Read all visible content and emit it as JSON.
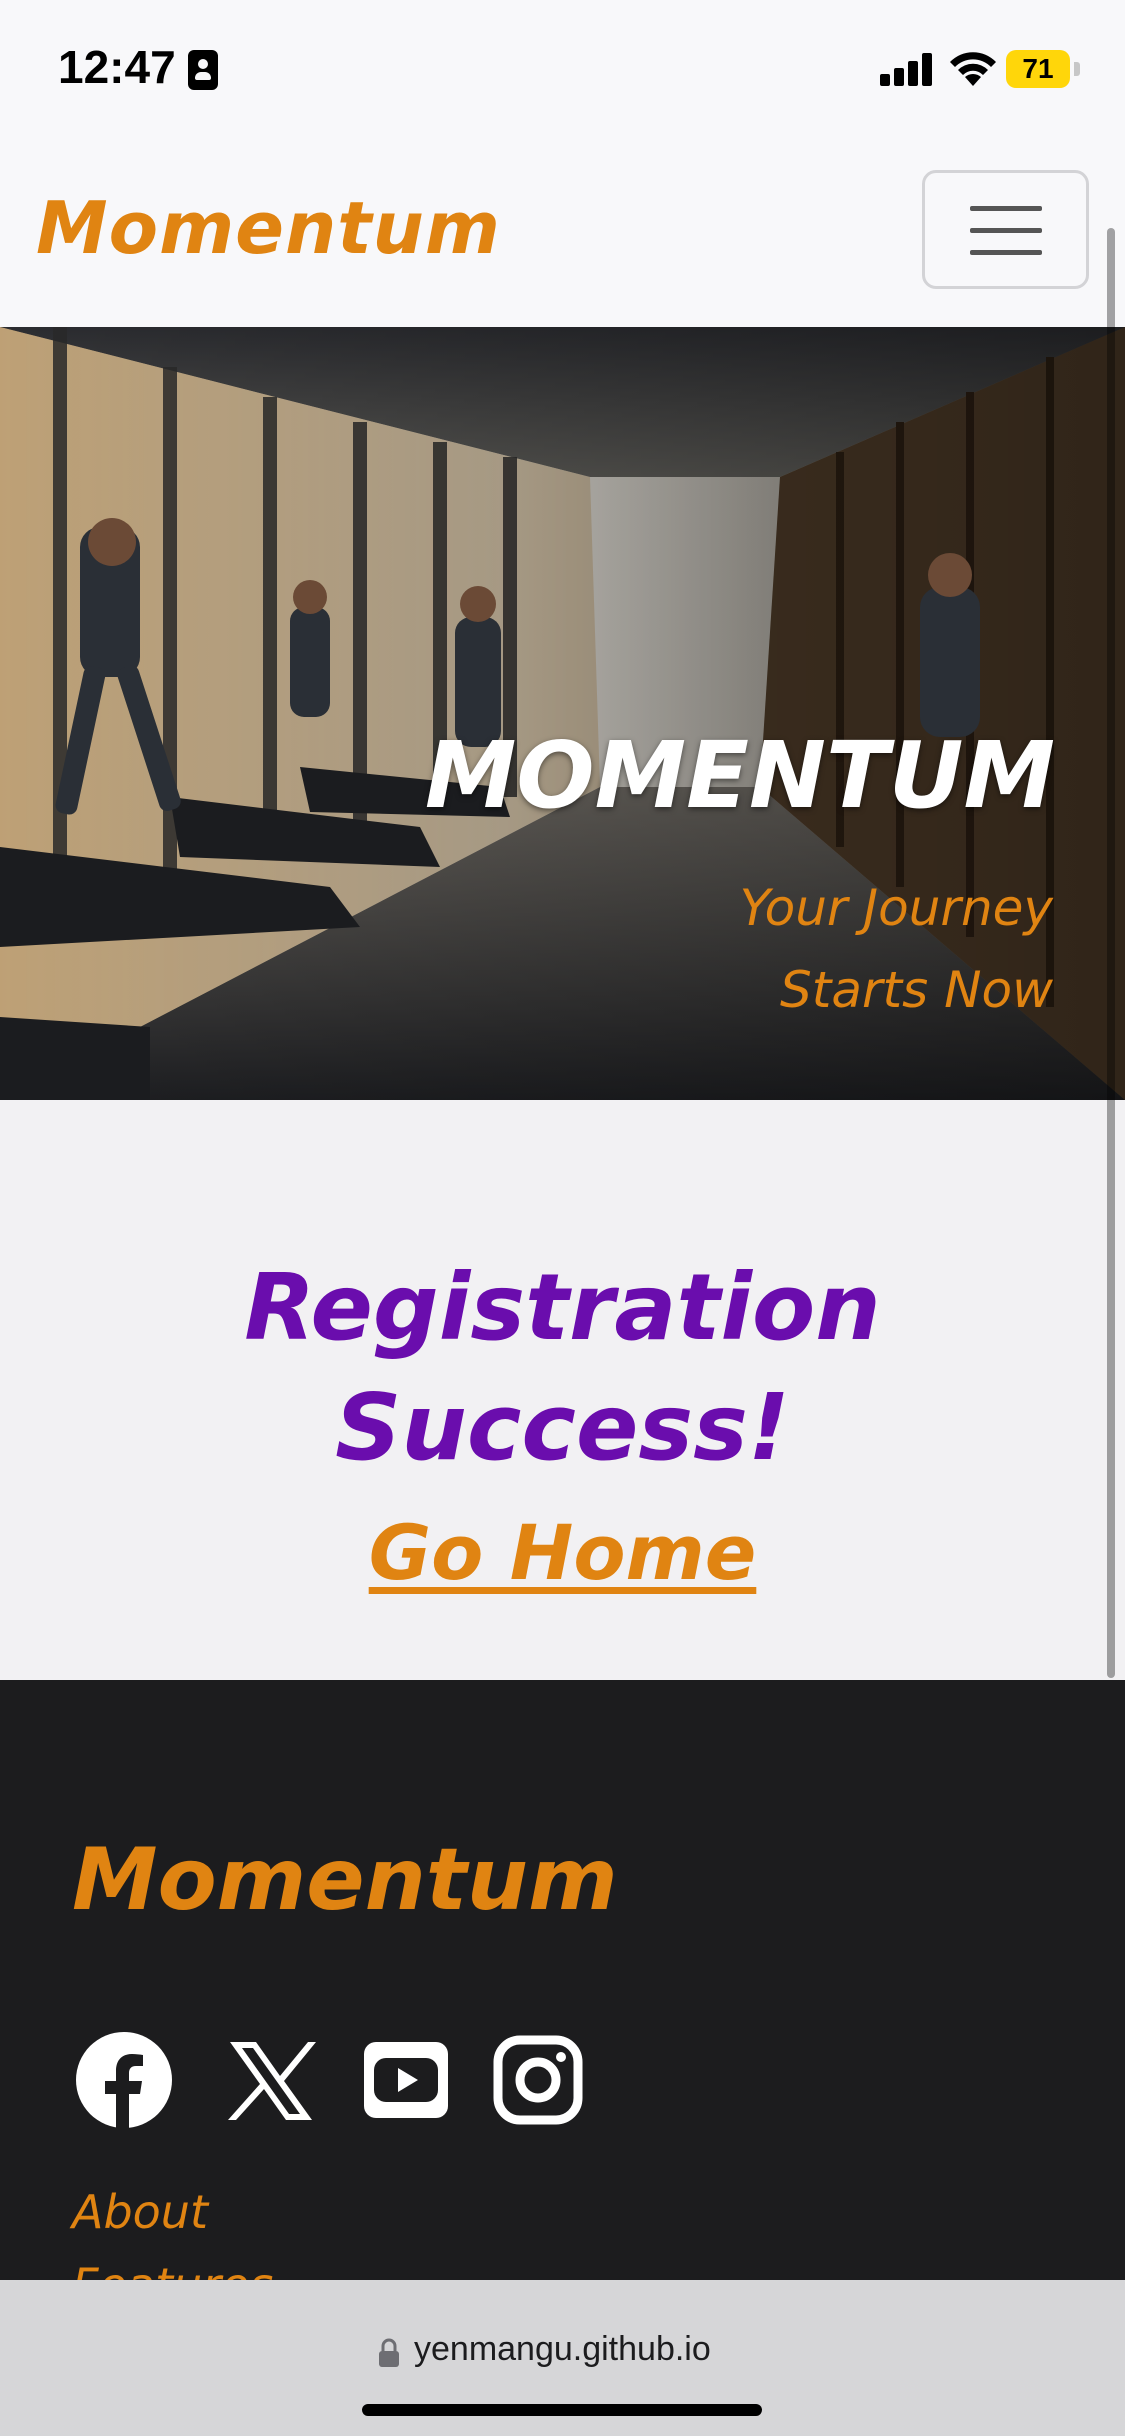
{
  "status_bar": {
    "time": "12:47",
    "battery": "71",
    "icons": [
      "id-card-icon",
      "signal-icon",
      "wifi-icon",
      "battery-icon"
    ]
  },
  "navbar": {
    "brand": "Momentum",
    "toggler_icon": "hamburger-menu-icon"
  },
  "hero": {
    "title": "MOMENTUM",
    "subtitle": "Your Journey Starts Now",
    "image": "gym-treadmills-photo"
  },
  "main": {
    "success_title": "Registration Success!",
    "go_home_link": "Go Home"
  },
  "footer": {
    "brand": "Momentum",
    "social_icons": [
      "facebook-icon",
      "x-icon",
      "youtube-icon",
      "instagram-icon"
    ],
    "links": [
      "About",
      "Features"
    ]
  },
  "browser": {
    "url": "yenmangu.github.io",
    "lock_icon": "lock-icon"
  },
  "colors": {
    "brand_orange": "#e08412",
    "success_purple": "#6a0dad",
    "footer_bg": "#1c1c1e",
    "battery_yellow": "#ffd60a"
  }
}
